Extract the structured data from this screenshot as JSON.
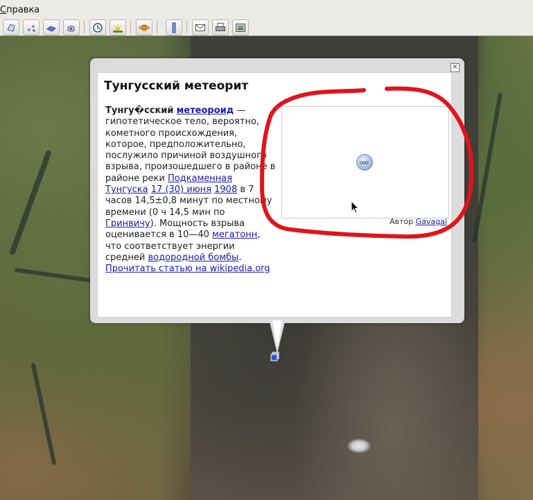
{
  "menu": {
    "help_label": "Справка",
    "help_mnemonic": "С",
    "help_rest": "правка"
  },
  "toolbar": {
    "buttons": [
      "add-polygon-icon",
      "add-placemark-icon",
      "add-path-icon",
      "add-overlay-icon",
      "historical-imagery-icon",
      "sunlight-icon",
      "planets-icon",
      "ruler-icon",
      "email-icon",
      "print-icon",
      "save-image-icon"
    ]
  },
  "balloon": {
    "title": "Тунгусский метеорит",
    "close_label": "×",
    "article": {
      "term": "Тунгу�сский",
      "meteoroid": "метеороид",
      "text1": " — гипотетическое тело, вероятно, кометного происхождения, которое, предположительно, послужило причиной воздушного взрыва, произошедшего в районе в районе реки ",
      "river_link": "Подкаменная Тунгуска",
      "date_link": "17 (30) июня",
      "year_link": "1908",
      "text2": " в 7 часов 14,5±0,8 минут по местному времени (0 ч 14,5 мин по ",
      "greenwich_link": "Гринвичу",
      "text3": "). Мощность взрыва оценивается в 10—40 ",
      "megaton_link": "мегатонн",
      "text4": ", что соответствует энергии средней ",
      "bomb_link": "водородной бомбы",
      "text5": ".",
      "wiki_link": "Прочитать статью на wikipedia.org"
    },
    "author_label": "Автор",
    "author_link": "Gavagai",
    "loader_label": "ooo"
  },
  "colors": {
    "link": "#1a1ab0",
    "annotation": "#e0141b"
  }
}
